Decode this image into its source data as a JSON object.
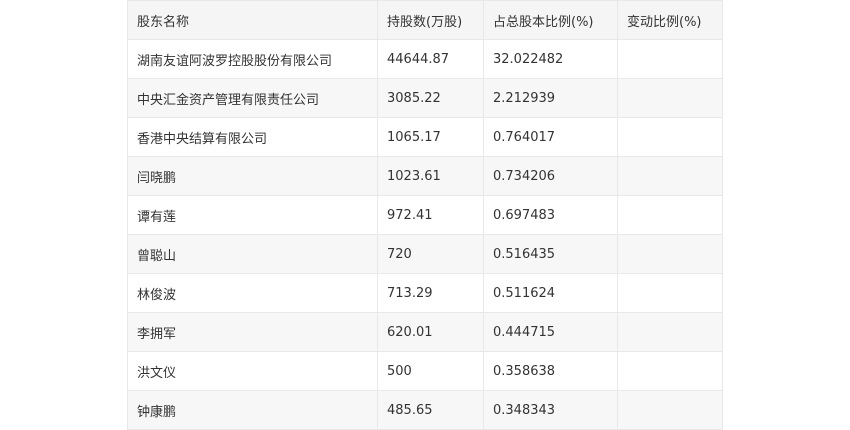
{
  "table": {
    "headers": [
      "股东名称",
      "持股数(万股)",
      "占总股本比例(%)",
      "变动比例(%)"
    ],
    "rows": [
      [
        "湖南友谊阿波罗控股股份有限公司",
        "44644.87",
        "32.022482",
        ""
      ],
      [
        "中央汇金资产管理有限责任公司",
        "3085.22",
        "2.212939",
        ""
      ],
      [
        "香港中央结算有限公司",
        "1065.17",
        "0.764017",
        ""
      ],
      [
        "闫晓鹏",
        "1023.61",
        "0.734206",
        ""
      ],
      [
        "谭有莲",
        "972.41",
        "0.697483",
        ""
      ],
      [
        "曾聪山",
        "720",
        "0.516435",
        ""
      ],
      [
        "林俊波",
        "713.29",
        "0.511624",
        ""
      ],
      [
        "李拥军",
        "620.01",
        "0.444715",
        ""
      ],
      [
        "洪文仪",
        "500",
        "0.358638",
        ""
      ],
      [
        "钟康鹏",
        "485.65",
        "0.348343",
        ""
      ]
    ]
  }
}
